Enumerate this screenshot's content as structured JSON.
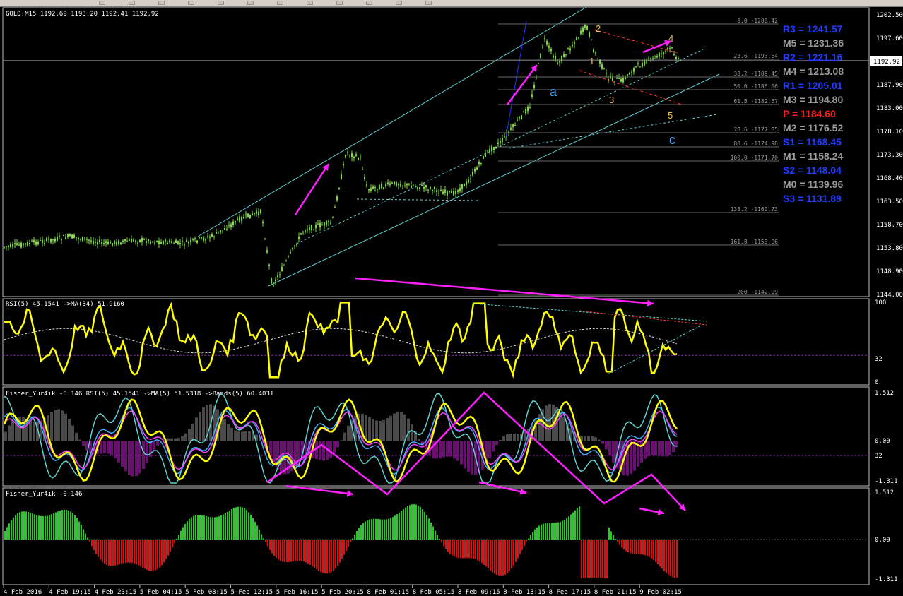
{
  "toolbar": {
    "buttons": 12
  },
  "main_chart": {
    "title": "GOLD,M15  1192.69 1193.20 1192.41 1192.92",
    "last_price": "1192.92",
    "price_axis": [
      "1202.50",
      "1197.60",
      "1192.92",
      "1187.90",
      "1183.00",
      "1178.10",
      "1173.30",
      "1168.40",
      "1163.50",
      "1158.70",
      "1153.80",
      "1148.90",
      "1144.00"
    ],
    "fib_levels": [
      {
        "label": "0.0 -1200.42"
      },
      {
        "label": "23.6 -1193.64"
      },
      {
        "label": "38.2 -1189.45"
      },
      {
        "label": "50.0 -1186.06"
      },
      {
        "label": "61.8 -1182.67"
      },
      {
        "label": "78.6 -1177.85"
      },
      {
        "label": "88.6 -1174.98"
      },
      {
        "label": "100.0 -1171.70"
      },
      {
        "label": "138.2 -1160.73"
      },
      {
        "label": "161.8 -1153.96"
      },
      {
        "label": "200 -1142.99"
      }
    ],
    "pivots": [
      {
        "text": "R3 = 1241.57",
        "color": "#1e3cff"
      },
      {
        "text": "M5 = 1231.36",
        "color": "#9a9a9a"
      },
      {
        "text": "R2 = 1221.16",
        "color": "#1e3cff"
      },
      {
        "text": "M4 = 1213.08",
        "color": "#9a9a9a"
      },
      {
        "text": "R1 = 1205.01",
        "color": "#1e3cff"
      },
      {
        "text": "M3 = 1194.80",
        "color": "#9a9a9a"
      },
      {
        "text": "P  = 1184.60",
        "color": "#ff1a1a"
      },
      {
        "text": "M2 = 1176.52",
        "color": "#9a9a9a"
      },
      {
        "text": "S1 = 1168.45",
        "color": "#1e3cff"
      },
      {
        "text": "M1 = 1158.24",
        "color": "#9a9a9a"
      },
      {
        "text": "S2 = 1148.04",
        "color": "#1e3cff"
      },
      {
        "text": "M0 = 1139.96",
        "color": "#9a9a9a"
      },
      {
        "text": "S3 = 1131.89",
        "color": "#1e3cff"
      }
    ],
    "wave_labels": [
      {
        "text": "a",
        "color": "#3aa9ff"
      },
      {
        "text": "c",
        "color": "#3aa9ff"
      },
      {
        "text": "1",
        "color": "#e8c04a"
      },
      {
        "text": "2",
        "color": "#e8c04a"
      },
      {
        "text": "3",
        "color": "#e8c04a"
      },
      {
        "text": "4",
        "color": "#e8c04a"
      },
      {
        "text": "5",
        "color": "#e8c04a"
      }
    ]
  },
  "rsi_panel": {
    "title": "RSI(5) 45.1541  ->MA(34) 51.9160",
    "axis": [
      "100",
      "32",
      "0"
    ]
  },
  "fisher_panel": {
    "title": "Fisher_Yur4ik -0.146  RSI(5) 45.1541  ->MA(5) 51.5318  ->Bands(5) 60.4031",
    "axis": [
      "1.512",
      "0.00",
      "32",
      "-1.311"
    ]
  },
  "fisher_hist_panel": {
    "title": "Fisher_Yur4ik -0.146",
    "axis": [
      "1.512",
      "0.00",
      "-1.311"
    ]
  },
  "time_axis": [
    "4 Feb 2016",
    "4 Feb 19:15",
    "4 Feb 23:15",
    "5 Feb 04:15",
    "5 Feb 08:15",
    "5 Feb 12:15",
    "5 Feb 16:15",
    "5 Feb 20:15",
    "8 Feb 01:15",
    "8 Feb 05:15",
    "8 Feb 09:15",
    "8 Feb 13:15",
    "8 Feb 17:15",
    "8 Feb 21:15",
    "9 Feb 02:15"
  ],
  "colors": {
    "candle": "#7ddc3a",
    "rsi": "#ffff00",
    "fisher_pos": "#22cc22",
    "fisher_neg": "#dd1111",
    "arrow": "#ff20ff",
    "channel": "#5fd3d3",
    "grid": "#c0c0c0"
  }
}
